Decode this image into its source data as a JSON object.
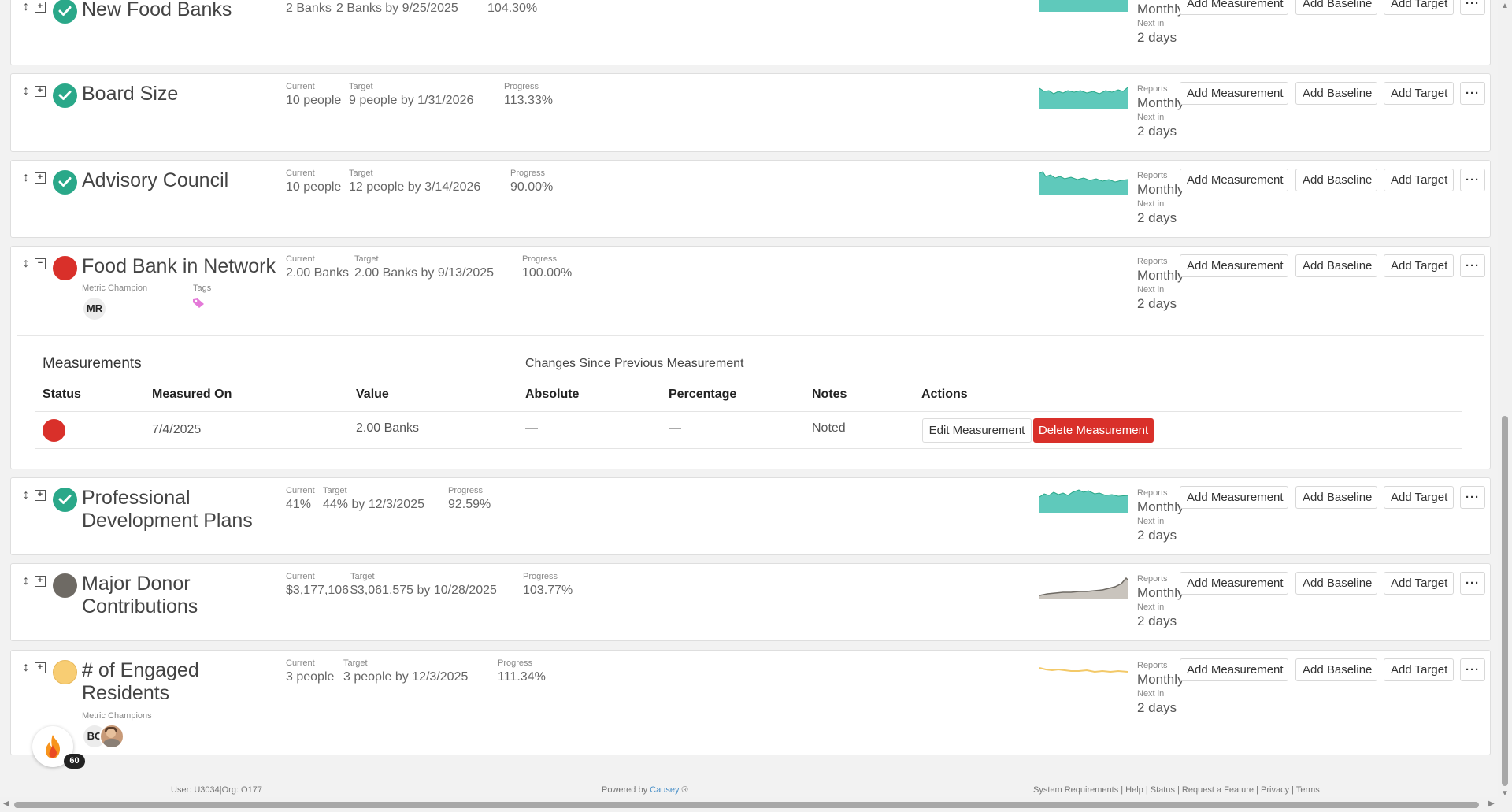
{
  "labels": {
    "current": "Current",
    "target": "Target",
    "progress": "Progress",
    "reports": "Reports",
    "next_in": "Next in",
    "add_measurement": "Add Measurement",
    "add_baseline": "Add Baseline",
    "add_target": "Add Target",
    "more": "···",
    "metric_champion": "Metric Champion",
    "metric_champions": "Metric Champions",
    "tags": "Tags"
  },
  "metrics": [
    {
      "name": "New Food Banks",
      "status": "on-track",
      "current": "2 Banks",
      "target": "2 Banks by 9/25/2025",
      "progress": "104.30%",
      "frequency": "Monthly",
      "next": "2 days"
    },
    {
      "name": "Board Size",
      "status": "on-track",
      "current": "10 people",
      "target": "9 people by 1/31/2026",
      "progress": "113.33%",
      "frequency": "Monthly",
      "next": "2 days"
    },
    {
      "name": "Advisory Council",
      "status": "on-track",
      "current": "10 people",
      "target": "12 people by 3/14/2026",
      "progress": "90.00%",
      "frequency": "Monthly",
      "next": "2 days"
    },
    {
      "name": "Food Bank in Network",
      "status": "off-track",
      "current": "2.00 Banks",
      "target": "2.00 Banks by 9/13/2025",
      "progress": "100.00%",
      "frequency": "Monthly",
      "next": "2 days",
      "champion_initials": "MR"
    },
    {
      "name": "Professional Development Plans",
      "status": "on-track",
      "current": "41%",
      "target": "44% by 12/3/2025",
      "progress": "92.59%",
      "frequency": "Monthly",
      "next": "2 days"
    },
    {
      "name": "Major Donor Contributions",
      "status": "neutral",
      "current": "$3,177,106",
      "target": "$3,061,575 by 10/28/2025",
      "progress": "103.77%",
      "frequency": "Monthly",
      "next": "2 days"
    },
    {
      "name": "# of Engaged Residents",
      "status": "at-risk",
      "current": "3 people",
      "target": "3 people by 12/3/2025",
      "progress": "111.34%",
      "frequency": "Monthly",
      "next": "2 days",
      "champion_initials": "BC"
    }
  ],
  "measurements": {
    "title": "Measurements",
    "changes_title": "Changes Since Previous Measurement",
    "headers": {
      "status": "Status",
      "measured_on": "Measured On",
      "value": "Value",
      "absolute": "Absolute",
      "percentage": "Percentage",
      "notes": "Notes",
      "actions": "Actions"
    },
    "rows": [
      {
        "status": "off-track",
        "measured_on": "7/4/2025",
        "value": "2.00 Banks",
        "absolute": "—",
        "percentage": "—",
        "notes": "Noted"
      }
    ],
    "edit_label": "Edit Measurement",
    "delete_label": "Delete Measurement"
  },
  "footer": {
    "user": "User: U3034|Org: O177",
    "powered_by": "Powered by",
    "brand": "Causey",
    "registered": "®",
    "links": "System Requirements | Help | Status | Request a Feature | Privacy | Terms"
  },
  "notification_count": "60",
  "colors": {
    "on_track": "#2aa889",
    "off_track": "#d9302a",
    "neutral": "#6e6a64",
    "at_risk": "#f8cd73",
    "link": "#4a90c8"
  },
  "icons": [
    "drag-handle-icon",
    "expand-icon",
    "collapse-icon",
    "check-icon",
    "tag-icon",
    "flame-icon",
    "more-icon"
  ]
}
